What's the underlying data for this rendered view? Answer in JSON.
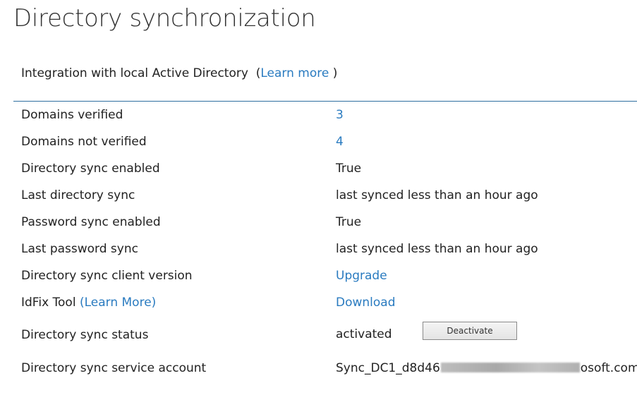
{
  "page": {
    "title": "Directory synchronization"
  },
  "intro": {
    "text": "Integration with local Active Directory",
    "open_paren": "(",
    "learn_more": "Learn more",
    "close_paren": ")"
  },
  "rows": [
    {
      "label": "Domains verified",
      "value": "3"
    },
    {
      "label": "Domains not verified",
      "value": "4"
    },
    {
      "label": "Directory sync enabled",
      "value": "True"
    },
    {
      "label": "Last directory sync",
      "value": "last synced less than an hour ago"
    },
    {
      "label": "Password sync enabled",
      "value": "True"
    },
    {
      "label": "Last password sync",
      "value": "last synced less than an hour ago"
    },
    {
      "label": "Directory sync client version",
      "value": "Upgrade"
    },
    {
      "label": "IdFix Tool",
      "label_link": "(Learn More)",
      "value": "Download"
    },
    {
      "label": "Directory sync status",
      "value": "activated",
      "button": "Deactivate"
    },
    {
      "label": "Directory sync service account",
      "value_prefix": "Sync_DC1_d8d46",
      "value_suffix": "osoft.com"
    }
  ],
  "colors": {
    "link": "#2a7bc0",
    "divider": "#2f6f9f",
    "text": "#222222"
  }
}
